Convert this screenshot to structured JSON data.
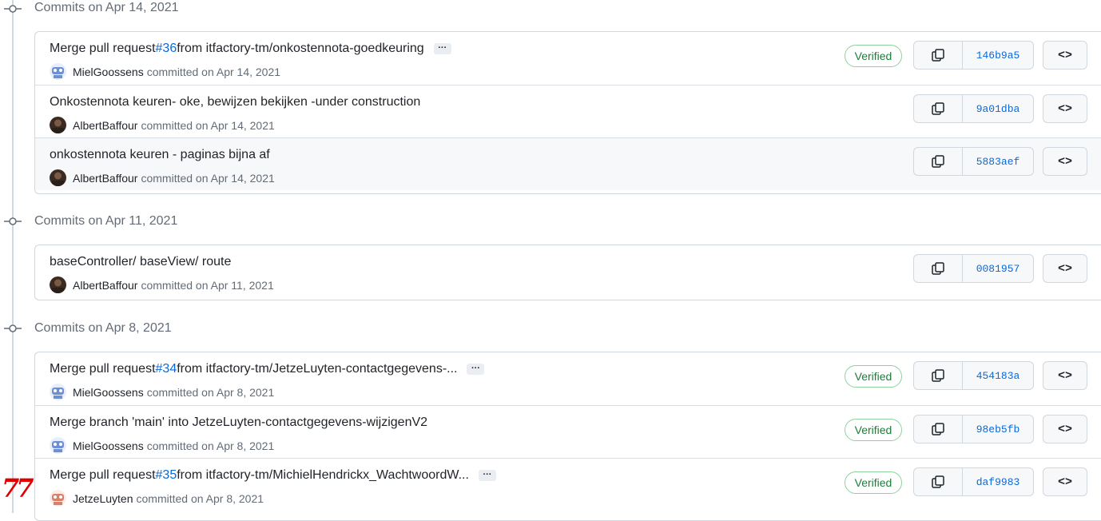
{
  "groups": [
    {
      "title": "Commits on Apr 14, 2021",
      "commits": [
        {
          "prefix": "Merge pull request ",
          "pr": "#36",
          "suffix": " from itfactory-tm/onkostennota-goedkeuring",
          "ellipsis": "···",
          "author": "MielGoossens",
          "avatar": "robot-blue",
          "committed": "committed on Apr 14, 2021",
          "verified": "Verified",
          "sha": "146b9a5"
        },
        {
          "prefix": "Onkostennota keuren- oke, bewijzen bekijken -under construction",
          "author": "AlbertBaffour",
          "avatar": "photo-dark",
          "committed": "committed on Apr 14, 2021",
          "sha": "9a01dba"
        },
        {
          "prefix": "onkostennota keuren - paginas bijna af",
          "author": "AlbertBaffour",
          "avatar": "photo-dark",
          "committed": "committed on Apr 14, 2021",
          "sha": "5883aef"
        }
      ]
    },
    {
      "title": "Commits on Apr 11, 2021",
      "commits": [
        {
          "prefix": "baseController/ baseView/ route",
          "author": "AlbertBaffour",
          "avatar": "photo-dark",
          "committed": "committed on Apr 11, 2021",
          "sha": "0081957"
        }
      ]
    },
    {
      "title": "Commits on Apr 8, 2021",
      "commits": [
        {
          "prefix": "Merge pull request ",
          "pr": "#34",
          "suffix": " from itfactory-tm/JetzeLuyten-contactgegevens-...",
          "ellipsis": "···",
          "author": "MielGoossens",
          "avatar": "robot-blue",
          "committed": "committed on Apr 8, 2021",
          "verified": "Verified",
          "sha": "454183a"
        },
        {
          "prefix": "Merge branch 'main' into JetzeLuyten-contactgegevens-wijzigenV2",
          "author": "MielGoossens",
          "avatar": "robot-blue",
          "committed": "committed on Apr 8, 2021",
          "verified": "Verified",
          "sha": "98eb5fb"
        },
        {
          "prefix": "Merge pull request ",
          "pr": "#35",
          "suffix": " from itfactory-tm/MichielHendrickx_WachtwoordW...",
          "ellipsis": "···",
          "author": "JetzeLuyten",
          "avatar": "robot-red",
          "committed": "committed on Apr 8, 2021",
          "verified": "Verified",
          "sha": "daf9983"
        }
      ]
    }
  ],
  "icons": {
    "commit": "git-commit-icon",
    "copy": "copy-icon",
    "browse": "code-icon"
  },
  "browse_label": "<>",
  "annotation": "77",
  "colors": {
    "link": "#0969da",
    "verified": "#1a7f37",
    "border": "#d0d7de",
    "muted": "#636c76"
  }
}
